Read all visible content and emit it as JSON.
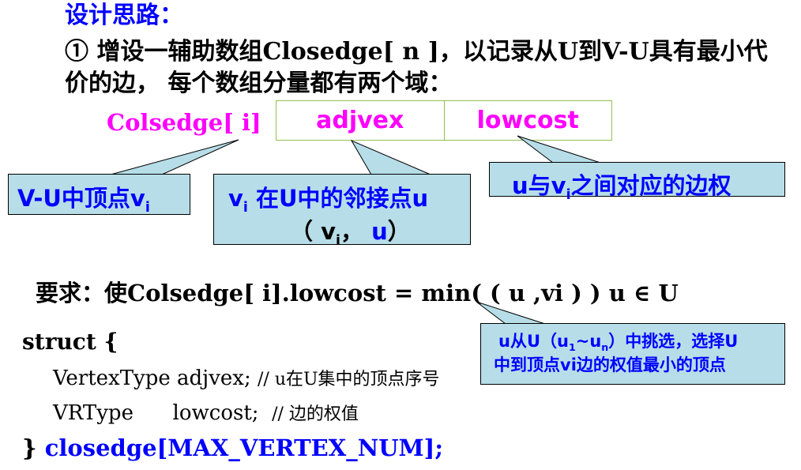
{
  "heading": "设计思路：",
  "line1": "① 增设一辅助数组Closedge[ n ]，以记录从U到V-U具有最小代",
  "line2": "价的边， 每个数组分量都有两个域：",
  "structure": {
    "label": "Colsedge[ i]",
    "fields": [
      "adjvex",
      "lowcost"
    ]
  },
  "callouts": {
    "vu": {
      "prefix": "V-U中顶点v",
      "sub": "i"
    },
    "vi": {
      "line1_v": "v",
      "line1_sub": "i",
      "line1_rest": " 在U中的邻接点u",
      "line2_open": "（ v",
      "line2_sub": "i",
      "line2_comma": "， ",
      "line2_u": "u",
      "line2_close": "）"
    },
    "u": {
      "prefix": "u与v",
      "sub": "i",
      "rest": "之间对应的边权"
    },
    "select": {
      "line1_a": "u从U（u",
      "line1_sub1": "1",
      "line1_b": "~u",
      "line1_sub2": "n",
      "line1_c": "）中挑选，选择U",
      "line2": "中到顶点vi边的权值最小的顶点"
    }
  },
  "requirement": "要求：使Colsedge[ i].lowcost = min( ( u ,vi ) )    u ∈ U",
  "code": {
    "open": "struct {",
    "member1_decl": "VertexType  adjvex;  ",
    "member1_comment": "// u在U集中的顶点序号",
    "member2_decl": "VRType      lowcost;  ",
    "member2_comment": "// 边的权值",
    "close_brace": "} ",
    "close_name": "closedge[MAX_VERTEX_NUM];"
  },
  "colors": {
    "blue": "#0000ff",
    "magenta": "#ff00ff",
    "callout_fill": "#b7dee8",
    "table_border": "#92c050"
  }
}
